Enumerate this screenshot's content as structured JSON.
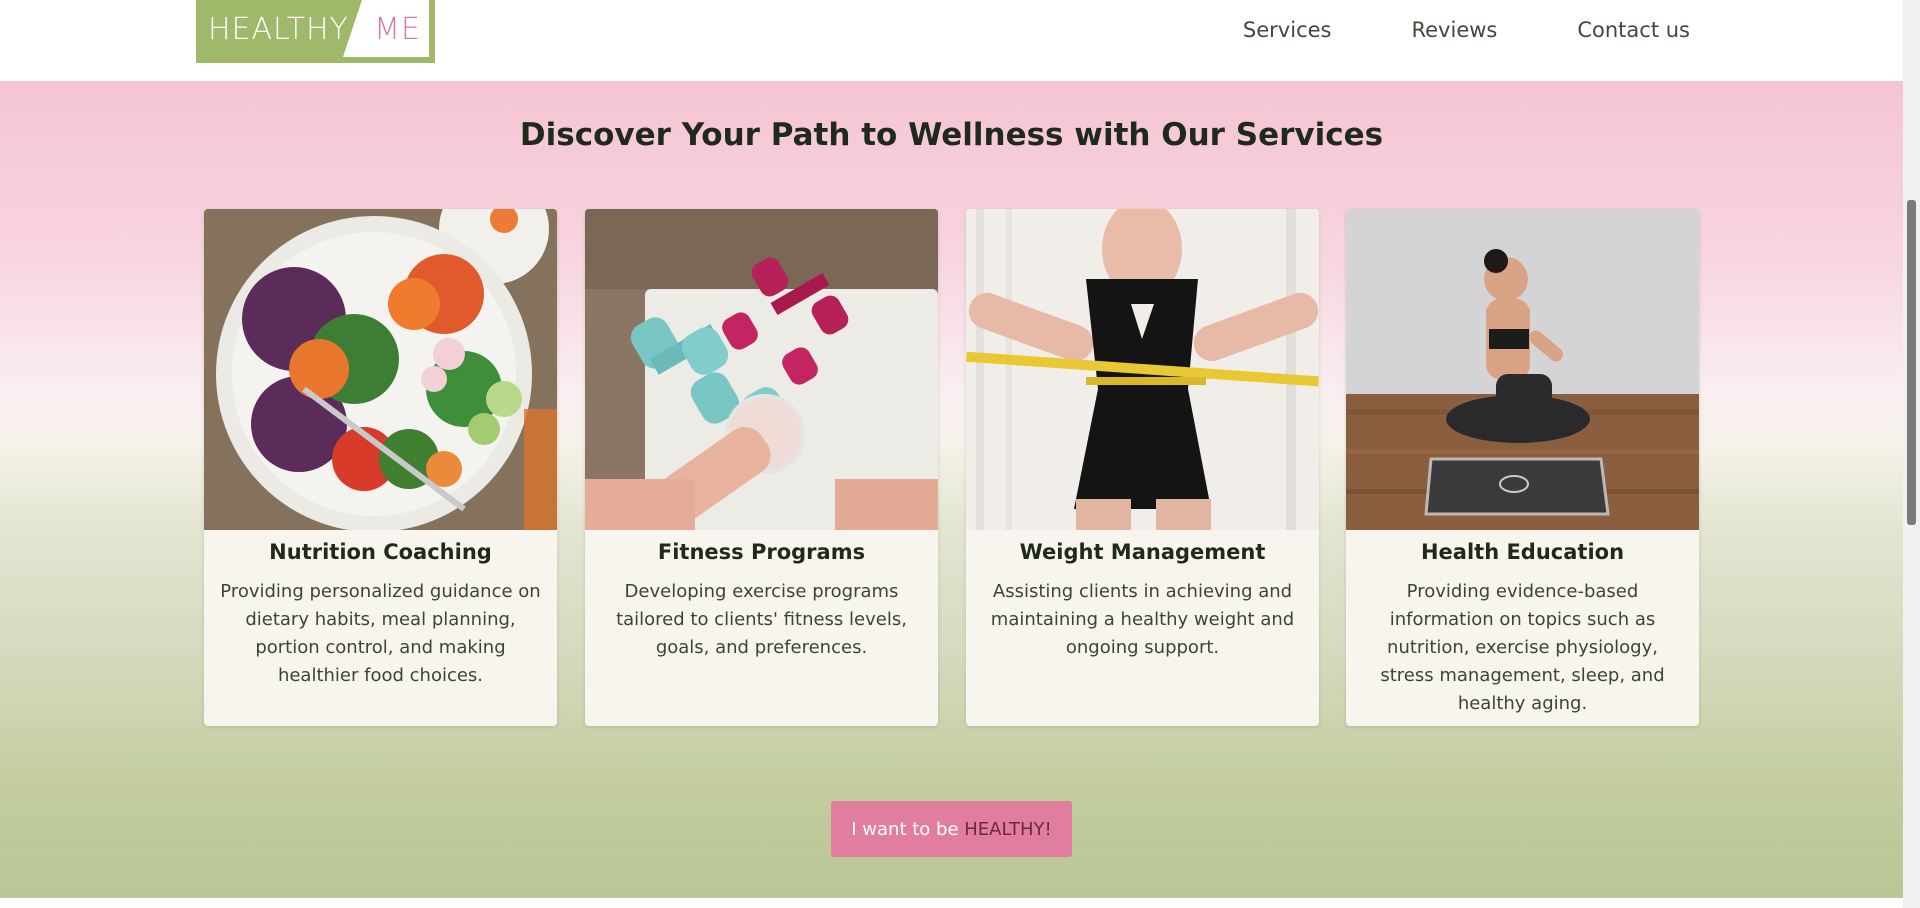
{
  "header": {
    "logo_healthy": "HEALTHY",
    "logo_me": "ME",
    "nav": [
      {
        "label": "Services"
      },
      {
        "label": "Reviews"
      },
      {
        "label": "Contact us"
      }
    ]
  },
  "main": {
    "title": "Discover Your Path to Wellness with Our Services",
    "cards": [
      {
        "image": "salad-bowl-photo",
        "title": "Nutrition Coaching",
        "desc": "Providing personalized guidance on dietary habits, meal planning, portion control, and making healthier food choices."
      },
      {
        "image": "dumbbells-smoothie-photo",
        "title": "Fitness Programs",
        "desc": "Developing exercise programs tailored to clients' fitness levels, goals, and preferences."
      },
      {
        "image": "tape-measure-waist-photo",
        "title": "Weight Management",
        "desc": "Assisting clients in achieving and maintaining a healthy weight and ongoing support."
      },
      {
        "image": "yoga-mat-photo",
        "title": "Health Education",
        "desc": "Providing evidence-based information on topics such as nutrition, exercise physiology, stress management, sleep, and healthy aging."
      }
    ],
    "cta_prefix": "I want to be ",
    "cta_accent": "HEALTHY!"
  },
  "colors": {
    "brand_green": "#9fb86a",
    "brand_pink": "#d97aa2",
    "cta_pink": "#e17d9f"
  }
}
